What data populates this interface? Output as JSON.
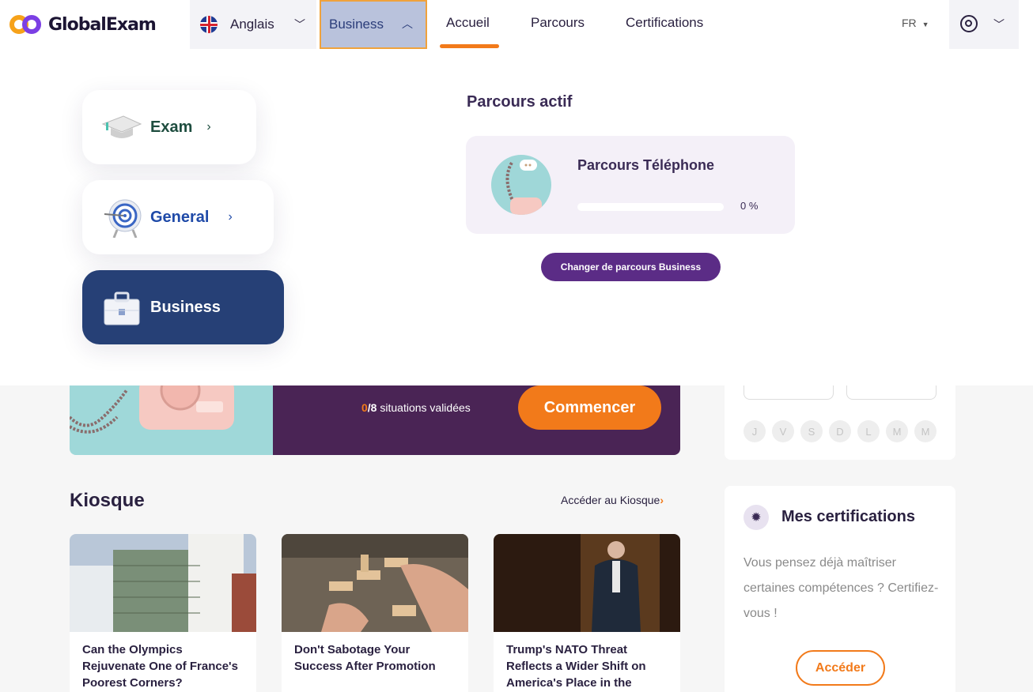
{
  "brand": {
    "name": "GlobalExam"
  },
  "nav": {
    "language": "Anglais",
    "section": "Business",
    "links": [
      "Accueil",
      "Parcours",
      "Certifications"
    ],
    "locale": "FR"
  },
  "menu": {
    "cards": [
      {
        "label": "Exam",
        "arrow": "›",
        "icon": "graduation-cap-icon"
      },
      {
        "label": "General",
        "arrow": "›",
        "icon": "target-icon"
      },
      {
        "label": "Business",
        "icon": "briefcase-icon"
      }
    ],
    "active_title": "Parcours actif",
    "active_parcours": {
      "name": "Parcours Téléphone",
      "progress_label": "0 %",
      "progress": 0
    },
    "change_button": "Changer de parcours Business"
  },
  "hero": {
    "done": "0",
    "sep": "/8",
    "label": "situations validées",
    "cta": "Commencer"
  },
  "kiosque": {
    "title": "Kiosque",
    "link": "Accéder au Kiosque",
    "link_arrow": "›",
    "articles": [
      {
        "title": "Can the Olympics Rejuvenate One of France's Poorest Corners?"
      },
      {
        "title": "Don't Sabotage Your Success After Promotion"
      },
      {
        "title": "Trump's NATO Threat Reflects a Wider Shift on America's Place in the"
      }
    ]
  },
  "sidebar": {
    "days": [
      "J",
      "V",
      "S",
      "D",
      "L",
      "M",
      "M"
    ],
    "cert_title": "Mes certifications",
    "cert_text": "Vous pensez déjà maîtriser certaines compétences ? Certifiez-vous !",
    "cert_button": "Accéder"
  },
  "colors": {
    "accent": "#f27a1a",
    "purple": "#5b2c86",
    "navy": "#264076"
  }
}
